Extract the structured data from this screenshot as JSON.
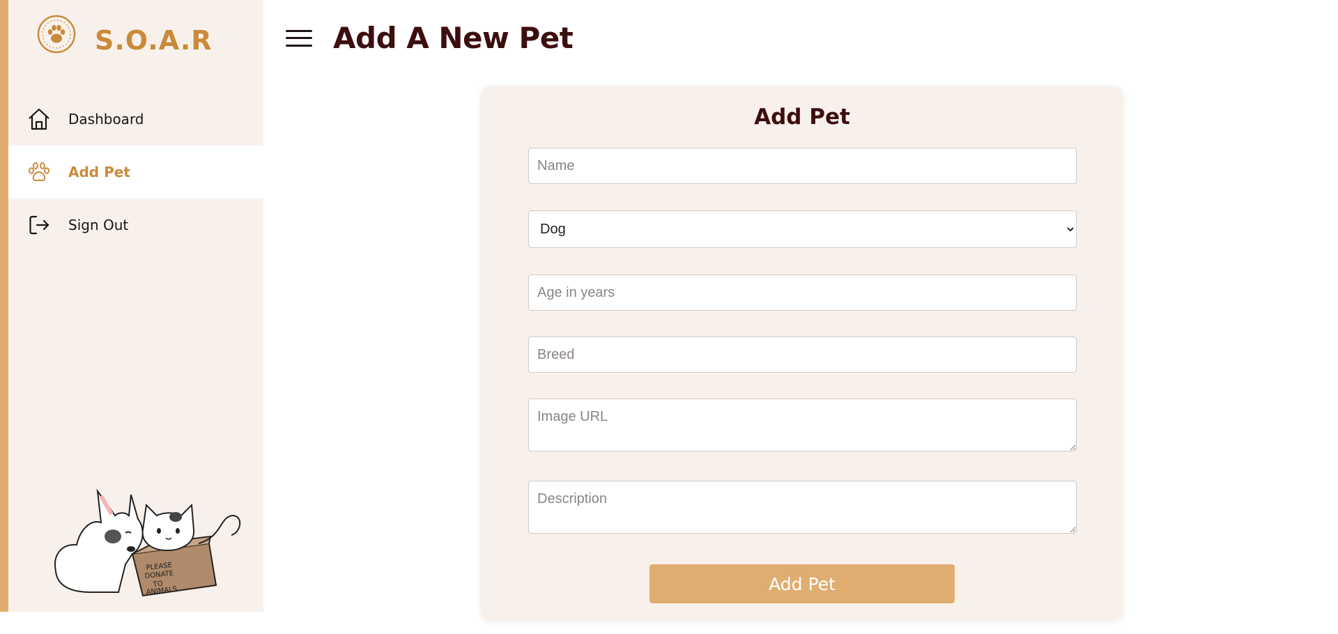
{
  "brand": {
    "title": "S.O.A.R",
    "logo_icon": "paw-circle-icon",
    "color": "#c98a3a"
  },
  "nav": {
    "items": [
      {
        "label": "Dashboard",
        "icon": "home-icon",
        "active": false
      },
      {
        "label": "Add Pet",
        "icon": "paw-icon",
        "active": true
      },
      {
        "label": "Sign Out",
        "icon": "sign-out-icon",
        "active": false
      }
    ]
  },
  "illustration": {
    "text": "PLEASE DONATE TO ANIMALS"
  },
  "header": {
    "title": "Add A New Pet",
    "menu_icon": "hamburger-menu-icon"
  },
  "form": {
    "title": "Add Pet",
    "name": {
      "placeholder": "Name",
      "value": ""
    },
    "species": {
      "selected": "Dog",
      "options": [
        "Dog"
      ]
    },
    "age": {
      "placeholder": "Age in years",
      "value": ""
    },
    "breed": {
      "placeholder": "Breed",
      "value": ""
    },
    "image_url": {
      "placeholder": "Image URL",
      "value": ""
    },
    "description": {
      "placeholder": "Description",
      "value": ""
    },
    "submit_label": "Add Pet"
  },
  "colors": {
    "accent": "#e0ad70",
    "sidebar_bg": "#f8f1eb",
    "title": "#3d0e0e"
  }
}
